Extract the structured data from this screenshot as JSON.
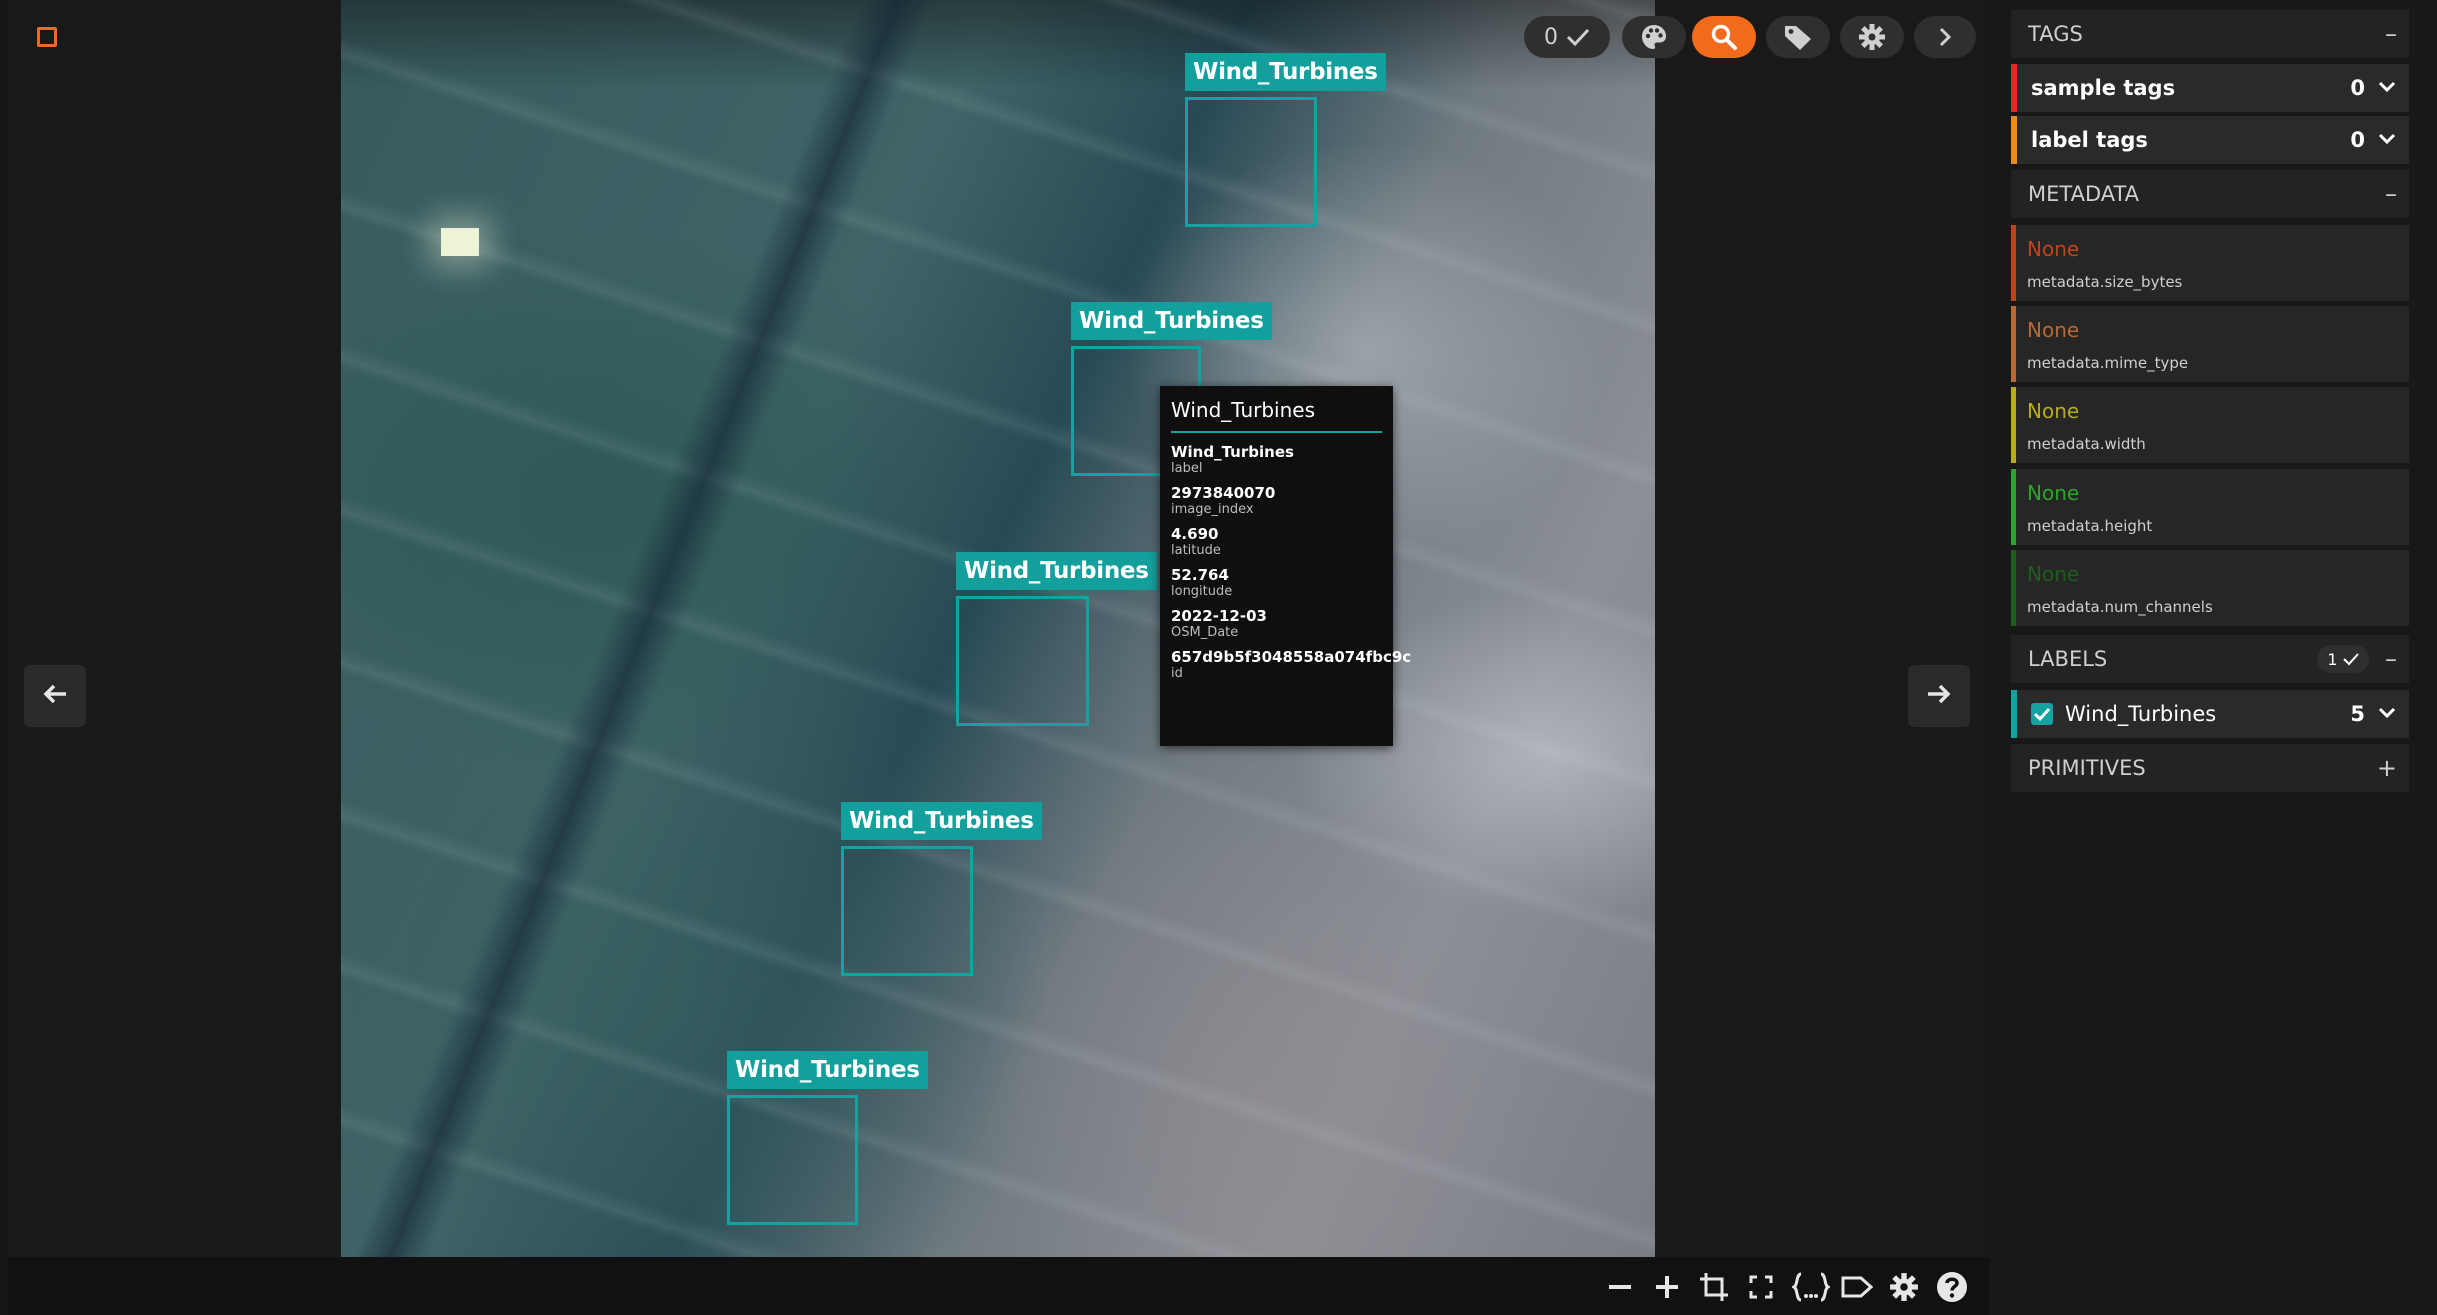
{
  "colors": {
    "accent_orange": "#f26b1d",
    "bbox_teal": "#14a3a0",
    "sample_tags_strip": "#e82424",
    "label_tags_strip": "#f08a1c",
    "meta_colors": [
      "#c0441a",
      "#b86a33",
      "#b7ad1a",
      "#2aa52a",
      "#1d5e1d"
    ]
  },
  "toolbar": {
    "selected_count": "0",
    "icons": [
      "check-icon",
      "palette-icon",
      "search-icon",
      "tag-icon",
      "gear-icon",
      "chevron-right-icon"
    ]
  },
  "boxes": [
    {
      "label": "Wind_Turbines"
    },
    {
      "label": "Wind_Turbines"
    },
    {
      "label": "Wind_Turbines"
    },
    {
      "label": "Wind_Turbines"
    },
    {
      "label": "Wind_Turbines"
    }
  ],
  "tooltip": {
    "title": "Wind_Turbines",
    "fields": [
      {
        "value": "Wind_Turbines",
        "key": "label"
      },
      {
        "value": "2973840070",
        "key": "image_index"
      },
      {
        "value": "4.690",
        "key": "latitude"
      },
      {
        "value": "52.764",
        "key": "longitude"
      },
      {
        "value": "2022-12-03",
        "key": "OSM_Date"
      },
      {
        "value": "657d9b5f3048558a074fbc9c",
        "key": "id"
      }
    ]
  },
  "sidebar": {
    "tags": {
      "header": "TAGS",
      "rows": [
        {
          "label": "sample tags",
          "count": "0"
        },
        {
          "label": "label tags",
          "count": "0"
        }
      ]
    },
    "metadata": {
      "header": "METADATA",
      "rows": [
        {
          "value": "None",
          "key": "metadata.size_bytes"
        },
        {
          "value": "None",
          "key": "metadata.mime_type"
        },
        {
          "value": "None",
          "key": "metadata.width"
        },
        {
          "value": "None",
          "key": "metadata.height"
        },
        {
          "value": "None",
          "key": "metadata.num_channels"
        }
      ]
    },
    "labels": {
      "header": "LABELS",
      "badge": "1",
      "rows": [
        {
          "label": "Wind_Turbines",
          "count": "5",
          "checked": true
        }
      ]
    },
    "primitives": {
      "header": "PRIMITIVES"
    }
  },
  "bottom_toolbar": {
    "icons": [
      "zoom-out-icon",
      "zoom-in-icon",
      "crop-icon",
      "fullscreen-icon",
      "json-icon",
      "label-icon",
      "settings-icon",
      "help-icon"
    ]
  }
}
